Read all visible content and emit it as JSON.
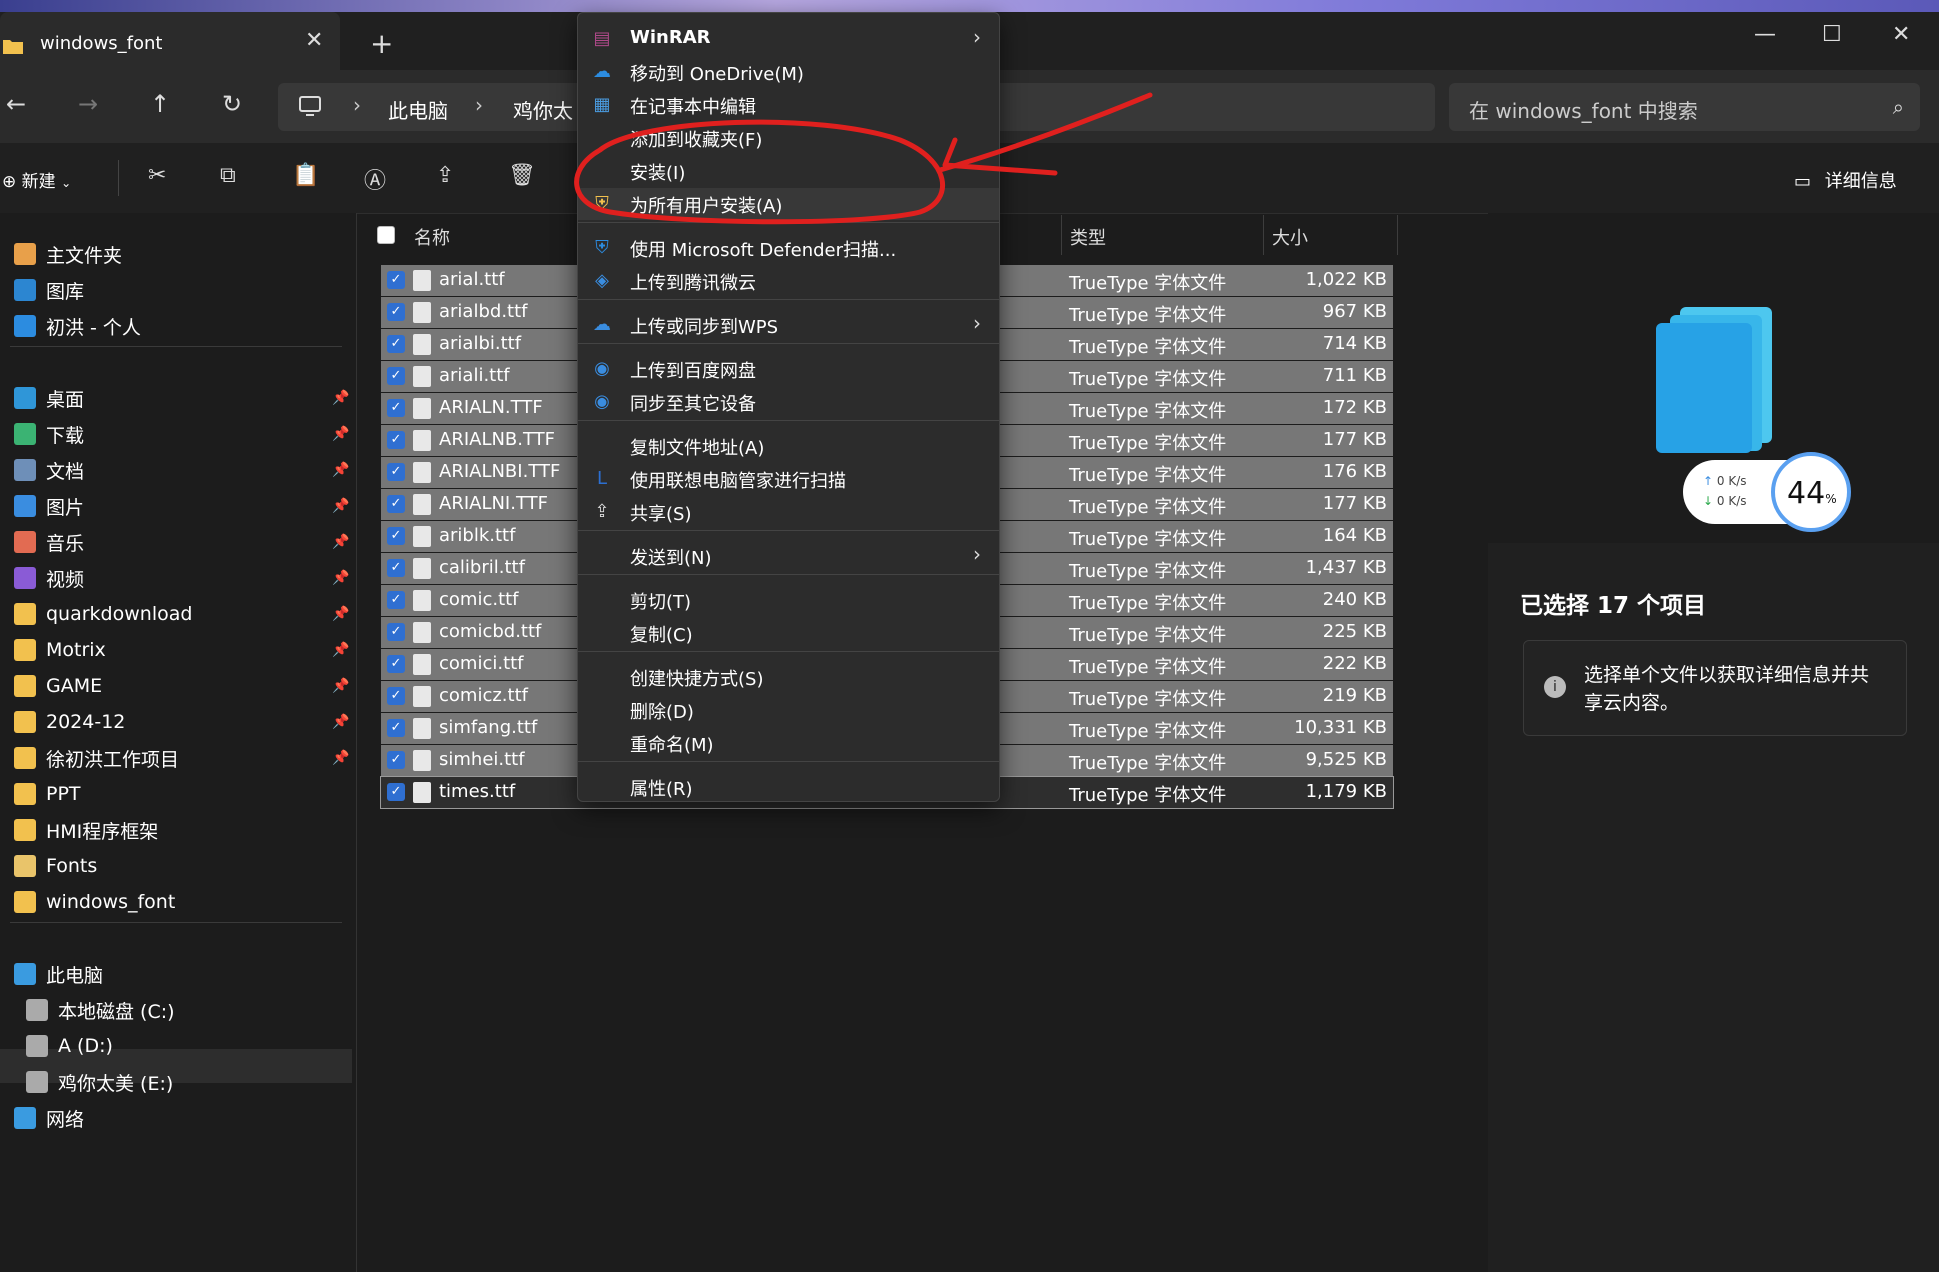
{
  "window": {
    "tab_title": "windows_font",
    "new_tab": "+",
    "close_tab": "✕",
    "minimize": "—",
    "maximize": "☐",
    "close": "✕"
  },
  "nav": {
    "back": "←",
    "forward": "→",
    "up": "↑",
    "refresh": "↻",
    "breadcrumb": [
      "此电脑",
      "鸡你太"
    ],
    "search_placeholder": "在 windows_font 中搜索"
  },
  "toolbar": {
    "new_label": "新建",
    "details_label": "详细信息"
  },
  "sidebar": {
    "quick": [
      {
        "label": "主文件夹",
        "icon": "home-icon",
        "color": "#e8a04a"
      },
      {
        "label": "图库",
        "icon": "gallery-icon",
        "color": "#2c86d1"
      },
      {
        "label": "初洪 - 个人",
        "icon": "onedrive-icon",
        "color": "#2c8ce0"
      }
    ],
    "pinned": [
      {
        "label": "桌面",
        "icon": "desktop-icon",
        "color": "#2f96d8"
      },
      {
        "label": "下载",
        "icon": "download-icon",
        "color": "#3bb373"
      },
      {
        "label": "文档",
        "icon": "document-icon",
        "color": "#6e8fb8"
      },
      {
        "label": "图片",
        "icon": "pictures-icon",
        "color": "#3a8de0"
      },
      {
        "label": "音乐",
        "icon": "music-icon",
        "color": "#e26b52"
      },
      {
        "label": "视频",
        "icon": "video-icon",
        "color": "#8a5bd6"
      },
      {
        "label": "quarkdownload",
        "icon": "folder-icon",
        "color": "#f2c14e"
      },
      {
        "label": "Motrix",
        "icon": "folder-icon",
        "color": "#f2c14e"
      },
      {
        "label": "GAME",
        "icon": "folder-icon",
        "color": "#f2c14e"
      },
      {
        "label": "2024-12",
        "icon": "folder-icon",
        "color": "#f2c14e"
      },
      {
        "label": "徐初洪工作项目",
        "icon": "folder-icon",
        "color": "#f2c14e"
      },
      {
        "label": "PPT",
        "icon": "folder-icon",
        "color": "#f2c14e"
      },
      {
        "label": "HMI程序框架",
        "icon": "folder-icon",
        "color": "#f2c14e"
      },
      {
        "label": "Fonts",
        "icon": "fonts-folder-icon",
        "color": "#e9c46a"
      },
      {
        "label": "windows_font",
        "icon": "folder-icon",
        "color": "#f2c14e"
      }
    ],
    "devices": [
      {
        "label": "此电脑",
        "icon": "pc-icon",
        "color": "#3a9be0"
      },
      {
        "label": "本地磁盘 (C:)",
        "icon": "drive-c-icon",
        "color": "#aaaaaa"
      },
      {
        "label": "A (D:)",
        "icon": "drive-icon",
        "color": "#aaaaaa"
      },
      {
        "label": "鸡你太美 (E:)",
        "icon": "drive-icon",
        "color": "#aaaaaa"
      },
      {
        "label": "网络",
        "icon": "network-icon",
        "color": "#3a9be0"
      }
    ]
  },
  "list": {
    "columns": {
      "name": "名称",
      "type": "类型",
      "size": "大小"
    },
    "rows": [
      {
        "name": "arial.ttf",
        "type": "TrueType 字体文件",
        "size": "1,022 KB"
      },
      {
        "name": "arialbd.ttf",
        "type": "TrueType 字体文件",
        "size": "967 KB"
      },
      {
        "name": "arialbi.ttf",
        "type": "TrueType 字体文件",
        "size": "714 KB"
      },
      {
        "name": "ariali.ttf",
        "type": "TrueType 字体文件",
        "size": "711 KB"
      },
      {
        "name": "ARIALN.TTF",
        "type": "TrueType 字体文件",
        "size": "172 KB"
      },
      {
        "name": "ARIALNB.TTF",
        "type": "TrueType 字体文件",
        "size": "177 KB"
      },
      {
        "name": "ARIALNBI.TTF",
        "type": "TrueType 字体文件",
        "size": "176 KB"
      },
      {
        "name": "ARIALNI.TTF",
        "type": "TrueType 字体文件",
        "size": "177 KB"
      },
      {
        "name": "ariblk.ttf",
        "type": "TrueType 字体文件",
        "size": "164 KB"
      },
      {
        "name": "calibril.ttf",
        "type": "TrueType 字体文件",
        "size": "1,437 KB"
      },
      {
        "name": "comic.ttf",
        "type": "TrueType 字体文件",
        "size": "240 KB"
      },
      {
        "name": "comicbd.ttf",
        "type": "TrueType 字体文件",
        "size": "225 KB"
      },
      {
        "name": "comici.ttf",
        "type": "TrueType 字体文件",
        "size": "222 KB"
      },
      {
        "name": "comicz.ttf",
        "type": "TrueType 字体文件",
        "size": "219 KB"
      },
      {
        "name": "simfang.ttf",
        "type": "TrueType 字体文件",
        "size": "10,331 KB"
      },
      {
        "name": "simhei.ttf",
        "type": "TrueType 字体文件",
        "size": "9,525 KB"
      },
      {
        "name": "times.ttf",
        "type": "TrueType 字体文件",
        "size": "1,179 KB"
      }
    ]
  },
  "details": {
    "selected": "已选择 17 个项目",
    "info": "选择单个文件以获取详细信息并共享云内容。"
  },
  "net_widget": {
    "up": "0  K/s",
    "down": "0  K/s",
    "percent": "44",
    "percent_unit": "%"
  },
  "context_menu": {
    "items": [
      {
        "label": "WinRAR",
        "icon": "winrar-icon",
        "submenu": true
      },
      {
        "label": "移动到 OneDrive(M)",
        "icon": "onedrive-icon"
      },
      {
        "label": "在记事本中编辑",
        "icon": "notepad-icon"
      },
      {
        "label": "添加到收藏夹(F)",
        "icon": ""
      },
      {
        "label": "安装(I)",
        "icon": ""
      },
      {
        "label": "为所有用户安装(A)",
        "icon": "uac-shield-icon",
        "highlighted": true
      },
      {
        "label": "使用 Microsoft Defender扫描...",
        "icon": "defender-icon"
      },
      {
        "label": "上传到腾讯微云",
        "icon": "weiyun-icon"
      },
      {
        "label": "上传或同步到WPS",
        "icon": "wps-cloud-icon",
        "submenu": true
      },
      {
        "label": "上传到百度网盘",
        "icon": "baidu-icon"
      },
      {
        "label": "同步至其它设备",
        "icon": "baidu-sync-icon"
      },
      {
        "label": "复制文件地址(A)",
        "icon": ""
      },
      {
        "label": "使用联想电脑管家进行扫描",
        "icon": "lenovo-icon"
      },
      {
        "label": "共享(S)",
        "icon": "share-icon"
      },
      {
        "label": "发送到(N)",
        "icon": "",
        "submenu": true
      },
      {
        "label": "剪切(T)",
        "icon": ""
      },
      {
        "label": "复制(C)",
        "icon": ""
      },
      {
        "label": "创建快捷方式(S)",
        "icon": ""
      },
      {
        "label": "删除(D)",
        "icon": ""
      },
      {
        "label": "重命名(M)",
        "icon": ""
      },
      {
        "label": "属性(R)",
        "icon": ""
      }
    ]
  },
  "colors": {
    "accent": "#2f6fd1",
    "annotation": "#e0201e",
    "selected_row": "#777777"
  }
}
